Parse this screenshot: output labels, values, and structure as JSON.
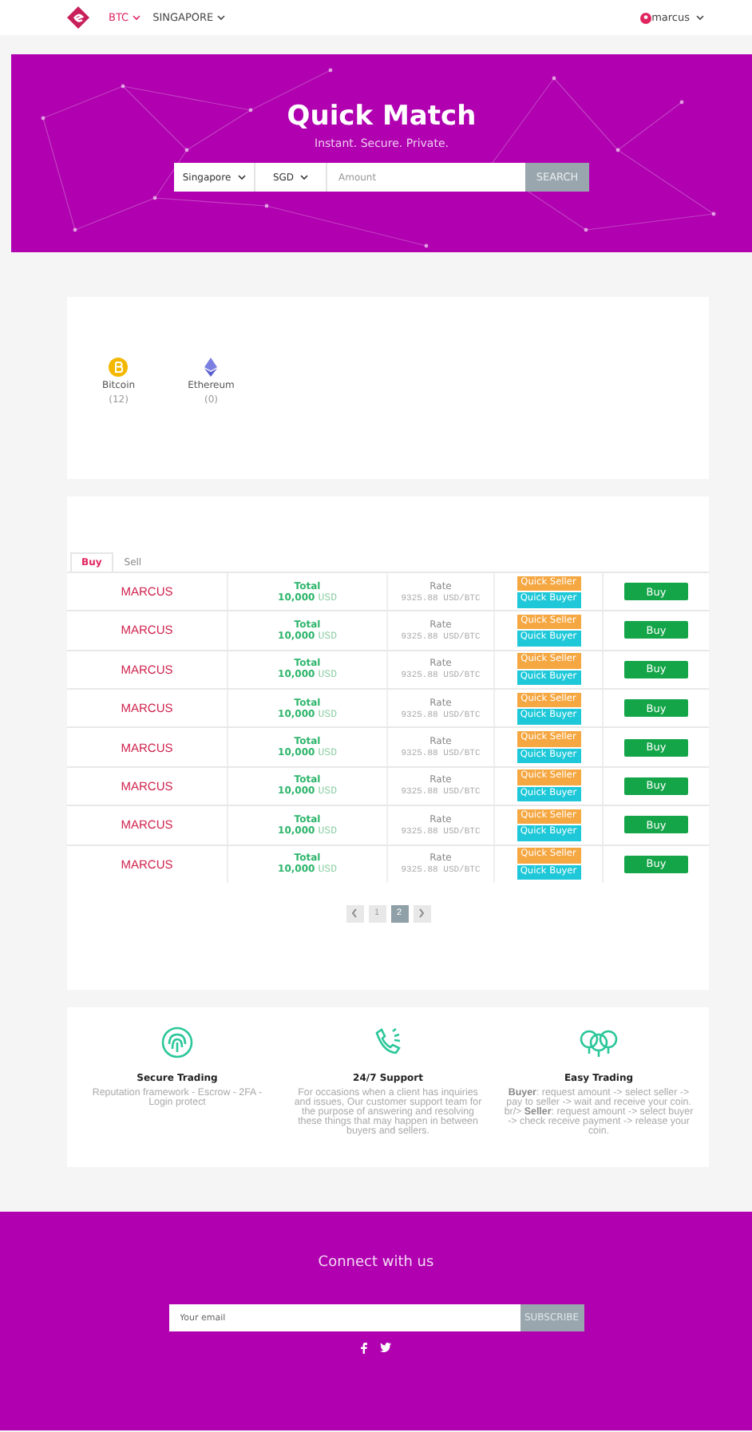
{
  "nav": {
    "currency": "BTC",
    "region": "SINGAPORE",
    "user": "marcus"
  },
  "hero": {
    "title": "Quick Match",
    "subtitle": "Instant. Secure. Private.",
    "location": "Singapore",
    "currency": "SGD",
    "amount_placeholder": "Amount",
    "button": "SEARCH"
  },
  "coins": [
    {
      "kind": "bitcoin",
      "name": "Bitcoin",
      "count": "(12)"
    },
    {
      "kind": "ethereum",
      "name": "Ethereum",
      "count": "(0)"
    }
  ],
  "tabs": [
    {
      "label": "Buy",
      "selected": true
    },
    {
      "label": "Sell",
      "selected": false
    }
  ],
  "offers": [
    {
      "trader": "MARCUS",
      "total_label": "Total",
      "amount": "10,000",
      "currency": "USD",
      "rate_label": "Rate",
      "rate": "9325.88 USD/BTC",
      "tags": [
        {
          "label": "Quick Seller",
          "color": "#f5a742"
        },
        {
          "label": "Quick Buyer",
          "color": "#1ec8d8"
        }
      ],
      "action": "Buy"
    },
    {
      "trader": "MARCUS",
      "total_label": "Total",
      "amount": "10,000",
      "currency": "USD",
      "rate_label": "Rate",
      "rate": "9325.88 USD/BTC",
      "tags": [
        {
          "label": "Quick Seller",
          "color": "#f5a742"
        },
        {
          "label": "Quick Buyer",
          "color": "#1ec8d8"
        }
      ],
      "action": "Buy"
    },
    {
      "trader": "MARCUS",
      "total_label": "Total",
      "amount": "10,000",
      "currency": "USD",
      "rate_label": "Rate",
      "rate": "9325.88 USD/BTC",
      "tags": [
        {
          "label": "Quick Seller",
          "color": "#f5a742"
        },
        {
          "label": "Quick Buyer",
          "color": "#1ec8d8"
        }
      ],
      "action": "Buy"
    },
    {
      "trader": "MARCUS",
      "total_label": "Total",
      "amount": "10,000",
      "currency": "USD",
      "rate_label": "Rate",
      "rate": "9325.88 USD/BTC",
      "tags": [
        {
          "label": "Quick Seller",
          "color": "#f5a742"
        },
        {
          "label": "Quick Buyer",
          "color": "#1ec8d8"
        }
      ],
      "action": "Buy"
    },
    {
      "trader": "MARCUS",
      "total_label": "Total",
      "amount": "10,000",
      "currency": "USD",
      "rate_label": "Rate",
      "rate": "9325.88 USD/BTC",
      "tags": [
        {
          "label": "Quick Seller",
          "color": "#f5a742"
        },
        {
          "label": "Quick Buyer",
          "color": "#1ec8d8"
        }
      ],
      "action": "Buy"
    },
    {
      "trader": "MARCUS",
      "total_label": "Total",
      "amount": "10,000",
      "currency": "USD",
      "rate_label": "Rate",
      "rate": "9325.88 USD/BTC",
      "tags": [
        {
          "label": "Quick Seller",
          "color": "#f5a742"
        },
        {
          "label": "Quick Buyer",
          "color": "#1ec8d8"
        }
      ],
      "action": "Buy"
    },
    {
      "trader": "MARCUS",
      "total_label": "Total",
      "amount": "10,000",
      "currency": "USD",
      "rate_label": "Rate",
      "rate": "9325.88 USD/BTC",
      "tags": [
        {
          "label": "Quick Seller",
          "color": "#f5a742"
        },
        {
          "label": "Quick Buyer",
          "color": "#1ec8d8"
        }
      ],
      "action": "Buy"
    },
    {
      "trader": "MARCUS",
      "total_label": "Total",
      "amount": "10,000",
      "currency": "USD",
      "rate_label": "Rate",
      "rate": "9325.88 USD/BTC",
      "tags": [
        {
          "label": "Quick Seller",
          "color": "#f5a742"
        },
        {
          "label": "Quick Buyer",
          "color": "#1ec8d8"
        }
      ],
      "action": "Buy"
    }
  ],
  "pagination": {
    "pages": [
      {
        "label": "1",
        "selected": false
      },
      {
        "label": "2",
        "selected": true
      }
    ]
  },
  "features": [
    {
      "kind": "fingerprint",
      "title": "Secure Trading",
      "text": "Reputation framework - Escrow - 2FA - Login protect"
    },
    {
      "kind": "phone",
      "title": "24/7 Support",
      "text": "For occasions when a client has inquiries and issues, Our customer support team for the purpose of answering and resolving these things that may happen in between buyers and sellers."
    },
    {
      "kind": "money",
      "title": "Easy Trading",
      "text": "**Buyer**: request amount -> select seller -> pay to seller -> wait and receive your coin. br/> **Seller**: request amount -> select buyer -> check receive payment -> release your coin."
    }
  ],
  "footer": {
    "heading": "Connect with us",
    "email_placeholder": "Your email",
    "button": "SUBSCRIBE"
  }
}
